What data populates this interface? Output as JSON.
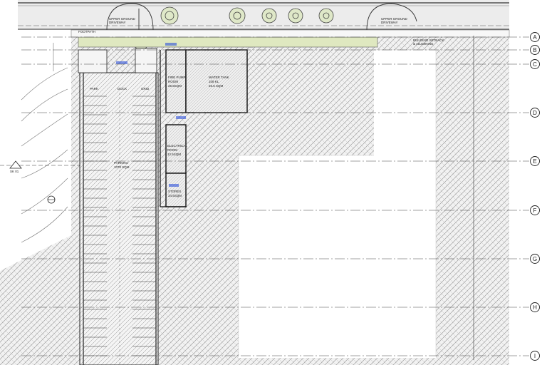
{
  "grid_labels": [
    "A",
    "B",
    "C",
    "D",
    "E",
    "F",
    "G",
    "H",
    "I"
  ],
  "rooms": {
    "fire_pump": [
      "FIRE PUMP",
      "ROOM",
      "25.5SQM"
    ],
    "water_tank": [
      "WATER TANK",
      "108 KL",
      "26.5 SQM"
    ],
    "electrical": [
      "ELECTRICAL",
      "ROOM",
      "12.5SQM"
    ],
    "stores": [
      "STORES",
      "34.5SQM"
    ],
    "parking": [
      "PARKING",
      "1070 SQM"
    ]
  },
  "labels": {
    "upper_driveway_left": [
      "UPPER GROUND",
      "DRIVEWAY"
    ],
    "upper_driveway_right": [
      "UPPER GROUND",
      "DRIVEWAY"
    ],
    "footpath": "FOOTPATH",
    "top_row": [
      "PARK",
      "DOCK",
      "GRID"
    ],
    "section_tag": "SK 01",
    "building_setback": [
      "BUILDING SETBACK",
      "& ADJOINING"
    ]
  },
  "colors": {
    "line": "#2a2a2a",
    "hatch": "#9a9a9a",
    "landscape": "#d9e6b8",
    "accent": "#2b4fd8"
  }
}
